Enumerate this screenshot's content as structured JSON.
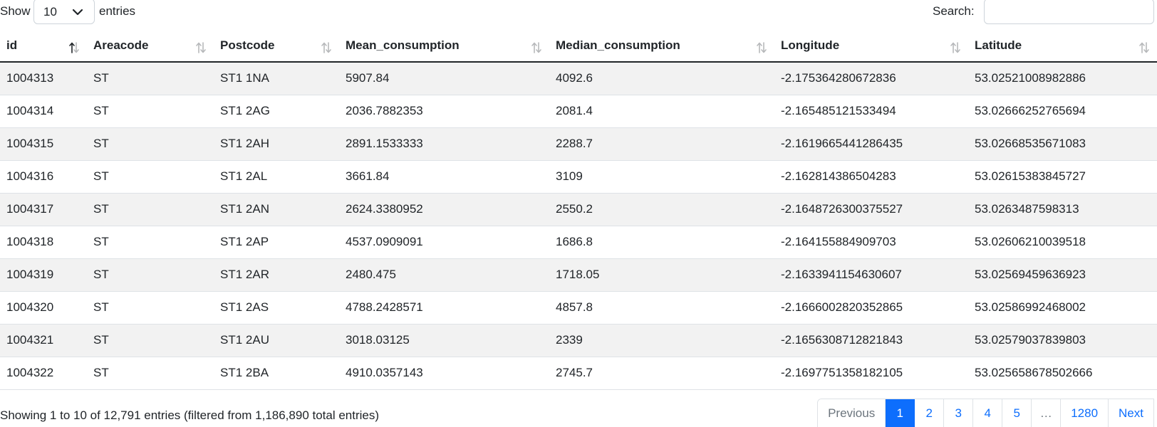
{
  "length_menu": {
    "show_label": "Show",
    "selected": "10",
    "entries_label": "entries"
  },
  "search": {
    "label": "Search:",
    "value": ""
  },
  "table": {
    "columns": [
      "id",
      "Areacode",
      "Postcode",
      "Mean_consumption",
      "Median_consumption",
      "Longitude",
      "Latitude"
    ],
    "sorted_column": "id",
    "sort_direction": "ascending",
    "rows": [
      [
        "1004313",
        "ST",
        "ST1 1NA",
        "5907.84",
        "4092.6",
        "-2.175364280672836",
        "53.02521008982886"
      ],
      [
        "1004314",
        "ST",
        "ST1 2AG",
        "2036.7882353",
        "2081.4",
        "-2.165485121533494",
        "53.02666252765694"
      ],
      [
        "1004315",
        "ST",
        "ST1 2AH",
        "2891.1533333",
        "2288.7",
        "-2.1619665441286435",
        "53.02668535671083"
      ],
      [
        "1004316",
        "ST",
        "ST1 2AL",
        "3661.84",
        "3109",
        "-2.162814386504283",
        "53.02615383845727"
      ],
      [
        "1004317",
        "ST",
        "ST1 2AN",
        "2624.3380952",
        "2550.2",
        "-2.1648726300375527",
        "53.0263487598313"
      ],
      [
        "1004318",
        "ST",
        "ST1 2AP",
        "4537.0909091",
        "1686.8",
        "-2.164155884909703",
        "53.02606210039518"
      ],
      [
        "1004319",
        "ST",
        "ST1 2AR",
        "2480.475",
        "1718.05",
        "-2.1633941154630607",
        "53.02569459636923"
      ],
      [
        "1004320",
        "ST",
        "ST1 2AS",
        "4788.2428571",
        "4857.8",
        "-2.1666002820352865",
        "53.02586992468002"
      ],
      [
        "1004321",
        "ST",
        "ST1 2AU",
        "3018.03125",
        "2339",
        "-2.1656308712821843",
        "53.02579037839803"
      ],
      [
        "1004322",
        "ST",
        "ST1 2BA",
        "4910.0357143",
        "2745.7",
        "-2.1697751358182105",
        "53.025658678502666"
      ]
    ]
  },
  "info": "Showing 1 to 10 of 12,791 entries (filtered from 1,186,890 total entries)",
  "pagination": {
    "previous": "Previous",
    "pages": [
      "1",
      "2",
      "3",
      "4",
      "5",
      "…",
      "1280"
    ],
    "active_page": "1",
    "next": "Next"
  },
  "colors": {
    "accent": "#0d6efd",
    "stripe": "#f2f2f2",
    "border": "#dee2e6"
  },
  "icons": {
    "length_dropdown": "chevron-down-icon",
    "column_sort": "sort-icon"
  }
}
